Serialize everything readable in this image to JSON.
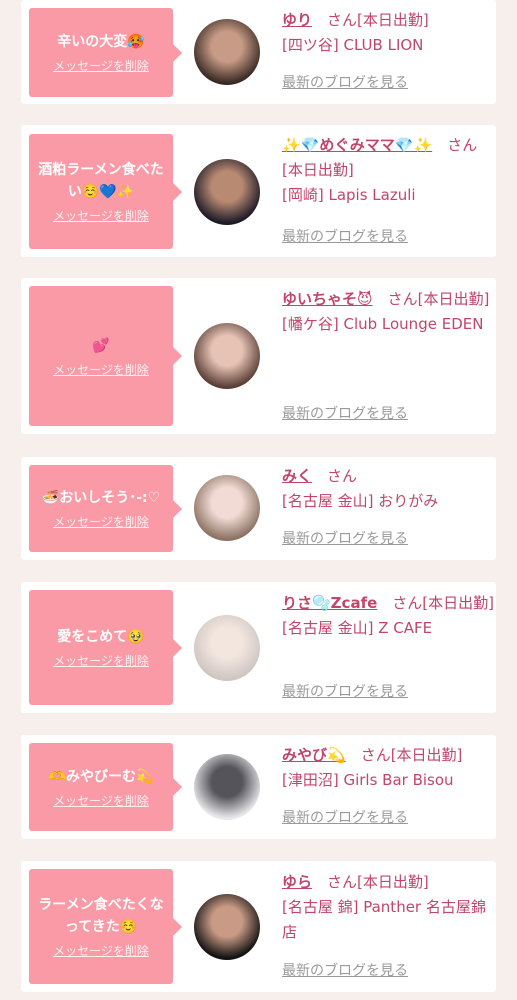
{
  "cards": [
    {
      "message": "辛いの大変🥵",
      "delete_label": "メッセージを削除",
      "name": "ゆり",
      "suffix": "さん[本日出勤]",
      "shop": "[四ツ谷] CLUB LION",
      "blog_label": "最新のブログを見る",
      "avatar_colors": [
        "#3a2a24",
        "#c79b86"
      ]
    },
    {
      "message": "酒粕ラーメン食べたい☺️💙✨",
      "delete_label": "メッセージを削除",
      "name": "✨💎めぐみママ💎✨",
      "suffix": "さん[本日出勤]",
      "shop": "[岡崎] Lapis Lazuli",
      "blog_label": "最新のブログを見る",
      "avatar_colors": [
        "#1d1a28",
        "#b98a72"
      ]
    },
    {
      "message": "💕",
      "delete_label": "メッセージを削除",
      "name": "ゆいちゃそ😈",
      "suffix": "さん[本日出勤]",
      "shop": "[幡ケ谷] Club Lounge EDEN",
      "blog_label": "最新のブログを見る",
      "avatar_colors": [
        "#5b3f36",
        "#e6c3b5"
      ]
    },
    {
      "message": "🍜おいしそう･-:♡",
      "delete_label": "メッセージを削除",
      "name": "みく",
      "suffix": "さん",
      "shop": "[名古屋 金山] おりがみ",
      "blog_label": "最新のブログを見る",
      "avatar_colors": [
        "#8c7364",
        "#f1dbd4"
      ]
    },
    {
      "message": "愛をこめて🥹",
      "delete_label": "メッセージを削除",
      "name": "りさ🫧Zcafe",
      "suffix": "さん[本日出勤]",
      "shop": "[名古屋 金山] Z CAFE",
      "blog_label": "最新のブログを見る",
      "avatar_colors": [
        "#cfc6c2",
        "#f3e6df"
      ]
    },
    {
      "message": "🫶みやびーむ💫",
      "delete_label": "メッセージを削除",
      "name": "みやび💫",
      "suffix": "さん[本日出勤]",
      "shop": "[津田沼] Girls Bar Bisou",
      "blog_label": "最新のブログを見る",
      "avatar_colors": [
        "#e9e9ec",
        "#55545a"
      ]
    },
    {
      "message": "ラーメン食べたくなってきた☺️",
      "delete_label": "メッセージを削除",
      "name": "ゆら",
      "suffix": "さん[本日出勤]",
      "shop": "[名古屋 錦] Panther 名古屋錦店",
      "blog_label": "最新のブログを見る",
      "avatar_colors": [
        "#121212",
        "#c99a85"
      ]
    }
  ]
}
